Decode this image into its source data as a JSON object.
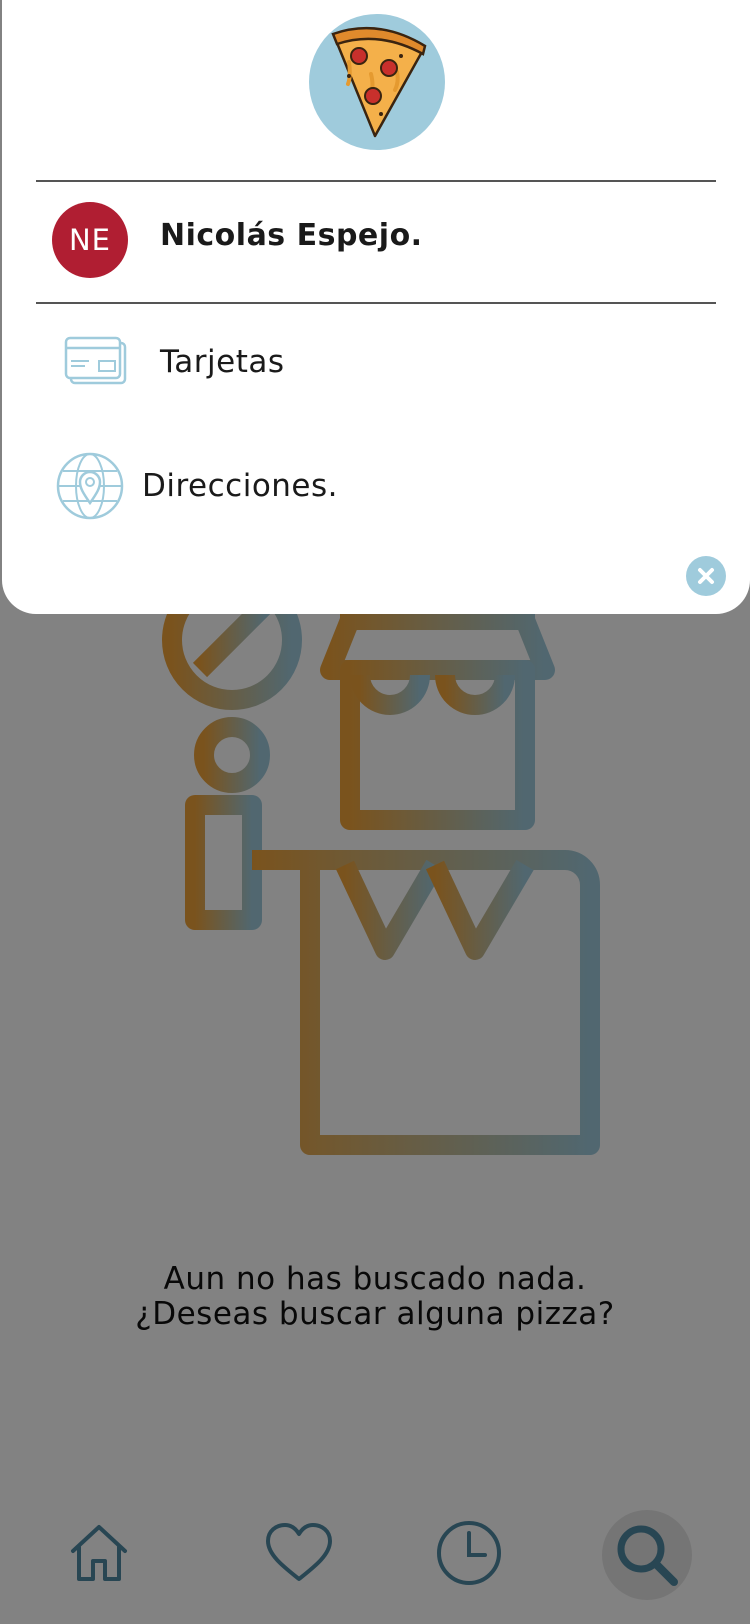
{
  "drawer": {
    "logo": "pizza-slice-logo",
    "user": {
      "initials": "NE",
      "name": "Nicolás Espejo."
    },
    "menu": [
      {
        "icon": "credit-cards-icon",
        "label": "Tarjetas"
      },
      {
        "icon": "globe-location-icon",
        "label": "Direcciones."
      }
    ],
    "close_icon": "close-icon"
  },
  "main": {
    "empty_state": {
      "illustration": "delivery-chef-illustration",
      "line1": "Aun no has buscado nada.",
      "line2": "¿Deseas buscar alguna pizza?"
    }
  },
  "bottom_nav": [
    {
      "icon": "home-icon"
    },
    {
      "icon": "heart-icon"
    },
    {
      "icon": "clock-icon"
    },
    {
      "icon": "search-icon",
      "active": true
    }
  ],
  "colors": {
    "accent": "#9fcbdc",
    "avatar_bg": "#b01e32",
    "nav_icon": "#4f8aa4"
  }
}
